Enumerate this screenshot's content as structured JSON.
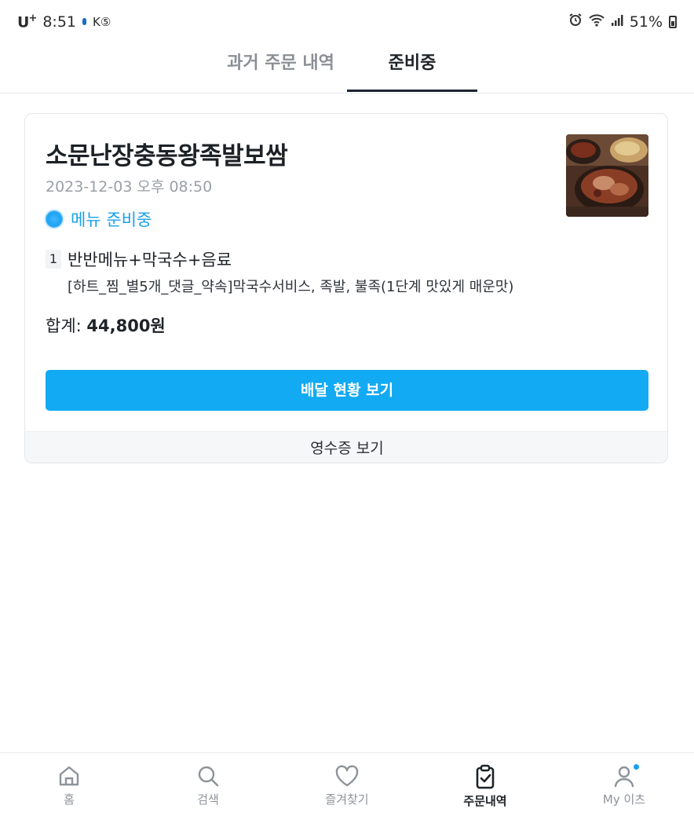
{
  "status_bar": {
    "carrier": "U",
    "carrier_sup": "+",
    "time": "8:51",
    "battery": "51%"
  },
  "tabs": {
    "past": "과거 주문 내역",
    "preparing": "준비중"
  },
  "order": {
    "store_name": "소문난장충동왕족발보쌈",
    "date": "2023-12-03 오후 08:50",
    "status": "메뉴 준비중",
    "item_qty": "1",
    "item_name": "반반메뉴+막국수+음료",
    "item_options": "[하트_찜_별5개_댓글_약속]막국수서비스, 족발, 불족(1단계 맛있게 매운맛)",
    "total_label": "합계: ",
    "total_value": "44,800원",
    "delivery_button": "배달 현황 보기",
    "receipt_button": "영수증 보기"
  },
  "bottom_nav": {
    "home": "홈",
    "search": "검색",
    "favorites": "즐겨찾기",
    "orders": "주문내역",
    "my": "My 이츠"
  },
  "colors": {
    "accent": "#12aaf3",
    "status": "#1aa0ea",
    "active_tab": "#1d2330"
  }
}
